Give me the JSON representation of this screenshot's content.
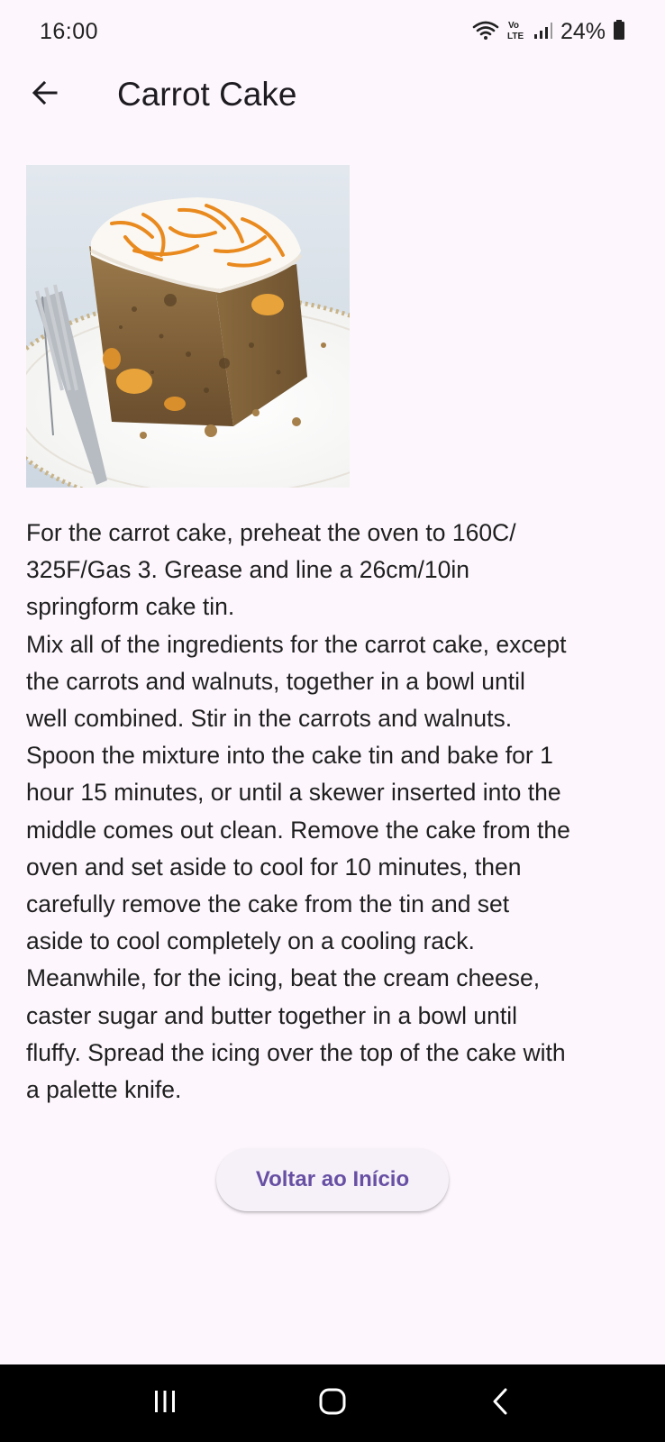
{
  "status_bar": {
    "time": "16:00",
    "battery": "24%",
    "icons": [
      "wifi-icon",
      "volte-icon",
      "signal-icon",
      "battery-icon"
    ]
  },
  "app_bar": {
    "back_icon": "arrow-left-icon",
    "title": "Carrot Cake"
  },
  "recipe": {
    "image_subject": "carrot-cake-slice-image",
    "instructions": "For the carrot cake, preheat the oven to 160C/\n325F/Gas 3. Grease and line a 26cm/10in\nspringform cake tin.\nMix all of the ingredients for the carrot cake, except\nthe carrots and walnuts, together in a bowl until\nwell combined. Stir in the carrots and walnuts.\nSpoon the mixture into the cake tin and bake for 1\nhour 15 minutes, or until a skewer inserted into the\nmiddle comes out clean. Remove the cake from the\noven and set aside to cool for 10 minutes, then\ncarefully remove the cake from the tin and set\naside to cool completely on a cooling rack.\nMeanwhile, for the icing, beat the cream cheese,\ncaster sugar and butter together in a bowl until\nfluffy. Spread the icing over the top of the cake with\na palette knife."
  },
  "actions": {
    "home_button_label": "Voltar ao Início"
  },
  "navigation": {
    "buttons": [
      "recent-apps-icon",
      "home-icon",
      "back-icon"
    ]
  },
  "colors": {
    "background": "#fdf7fd",
    "accent": "#6750a4",
    "button_bg": "#f6f1f8"
  }
}
